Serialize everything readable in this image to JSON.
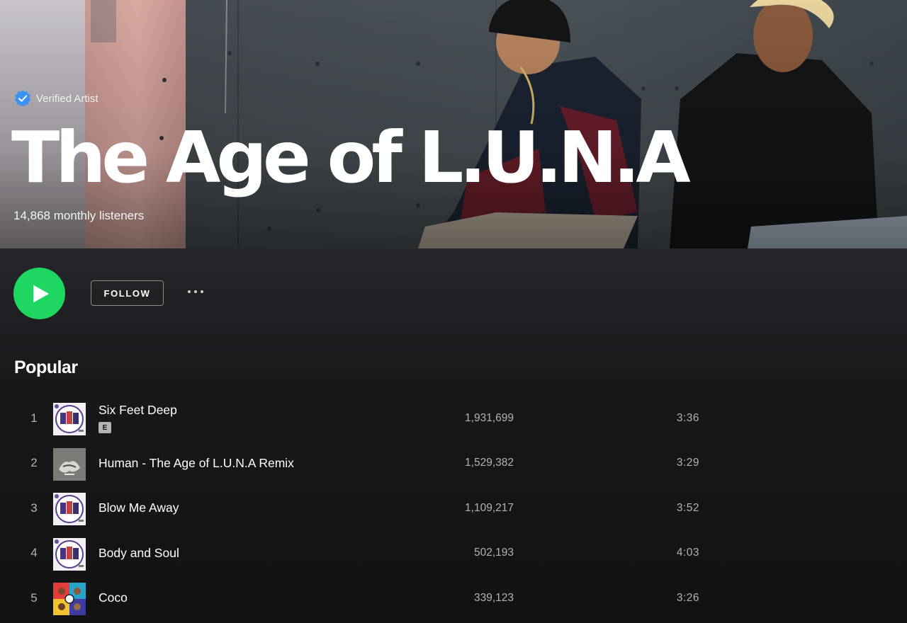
{
  "artist": {
    "verified_label": "Verified Artist",
    "name": "The Age of L.U.N.A",
    "monthly_listeners": "14,868 monthly listeners"
  },
  "actions": {
    "play_icon": "play-icon",
    "follow_label": "FOLLOW",
    "more_icon": "more-options-icon"
  },
  "popular": {
    "title": "Popular",
    "tracks": [
      {
        "number": "1",
        "title": "Six Feet Deep",
        "explicit": "E",
        "plays": "1,931,699",
        "duration": "3:36"
      },
      {
        "number": "2",
        "title": "Human - The Age of L.U.N.A Remix",
        "plays": "1,529,382",
        "duration": "3:29"
      },
      {
        "number": "3",
        "title": "Blow Me Away",
        "plays": "1,109,217",
        "duration": "3:52"
      },
      {
        "number": "4",
        "title": "Body and Soul",
        "plays": "502,193",
        "duration": "4:03"
      },
      {
        "number": "5",
        "title": "Coco",
        "plays": "339,123",
        "duration": "3:26"
      }
    ]
  },
  "colors": {
    "accent": "#1ed760",
    "background": "#121212",
    "verified_badge": "#3d91f4",
    "secondary_text": "#b3b3b3"
  }
}
